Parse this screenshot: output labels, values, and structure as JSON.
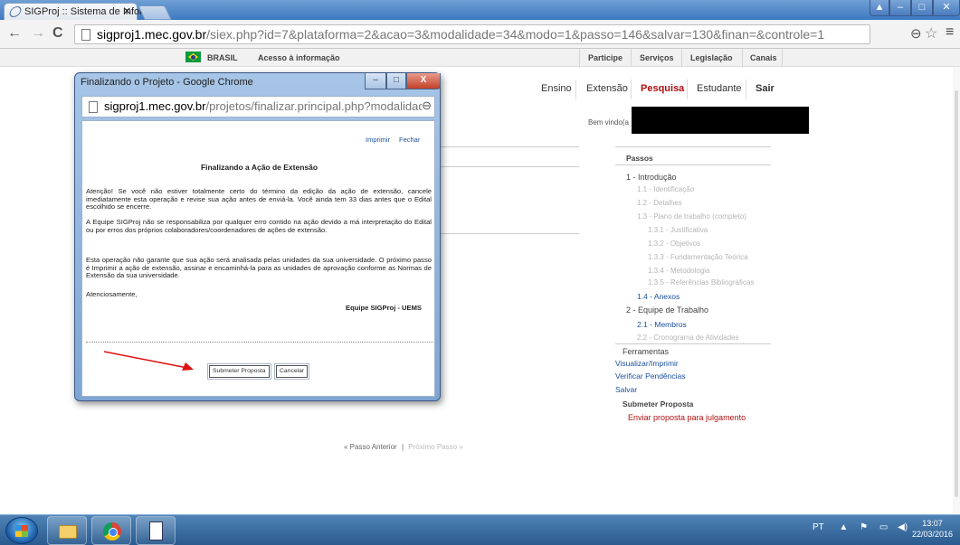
{
  "browser": {
    "tab_title": "SIGProj :: Sistema de Infor",
    "url_host": "sigproj1.mec.gov.br",
    "url_path": "/siex.php?id=7&plataforma=2&acao=3&modalidade=34&modo=1&passo=146&salvar=130&finan=&controle=1"
  },
  "govbar": {
    "brasil": "BRASIL",
    "acesso": "Acesso à informação",
    "links": [
      "Participe",
      "Serviços",
      "Legislação",
      "Canais"
    ]
  },
  "sitenav": {
    "items": [
      "Ensino",
      "Extensão",
      "Pesquisa",
      "Estudante",
      "Sair"
    ],
    "welcome": "Bem vindo(a"
  },
  "steps": {
    "header": "Passos",
    "intro": "1 - Introdução",
    "identificacao": "1.1 - Identificação",
    "detalhes": "1.2 - Detalhes",
    "plano": "1.3 - Plano de trabalho (completo)",
    "justificativa": "1.3.1 - Justificativa",
    "objetivos": "1.3.2 - Objetivos",
    "fundamentacao": "1.3.3 - Fundamentação Teórica",
    "metodologia": "1.3.4 - Metodologia",
    "referencias": "1.3.5 - Referências Bibliográficas",
    "anexos": "1.4 - Anexos",
    "equipe": "2 - Equipe de Trabalho",
    "membros": "2.1 - Membros",
    "cronograma": "2.2 - Cronograma de Atividades",
    "ferramentas": "Ferramentas",
    "visualizar": "Visualizar/Imprimir",
    "verificar": "Verificar Pendências",
    "salvar": "Salvar",
    "submeter": "Submeter Proposta",
    "enviar": "Enviar proposta para julgamento"
  },
  "pager": {
    "anterior": "« Passo Anterior",
    "sep": "|",
    "proximo": "Próximo Passo »"
  },
  "popup": {
    "window_title": "Finalizando o Projeto - Google Chrome",
    "url_host": "sigproj1.mec.gov.br",
    "url_path": "/projetos/finalizar.principal.php?modalidade",
    "imprimir": "Imprimir",
    "fechar": "Fechar",
    "title": "Finalizando a Ação de Extensão",
    "para1": "Atenção! Se você não estiver totalmente certo do término da edição da ação de extensão, cancele imediatamente esta operação e revise sua ação antes de enviá-la. Você ainda tem 33 dias antes que o Edital escolhido se encerre.",
    "para2": "A Equipe SIGProj não se responsabiliza por qualquer erro contido na ação devido a má interpretação do Edital ou por erros dos próprios colaboradores/coordenadores de ações de extensão.",
    "para3": "Esta operação não garante que sua ação será analisada pelas unidades da sua universidade. O próximo passo é Imprimir a ação de extensão, assinar e encaminhá-la para as unidades de aprovação conforme as Normas de Extensão da sua universidade.",
    "atenciosamente": "Atenciosamente,",
    "signature": "Equipe SIGProj - UEMS",
    "submit_label": "Submeter Proposta",
    "cancel_label": "Cancelar"
  },
  "taskbar": {
    "lang": "PT",
    "time": "13:07",
    "date": "22/03/2016"
  }
}
